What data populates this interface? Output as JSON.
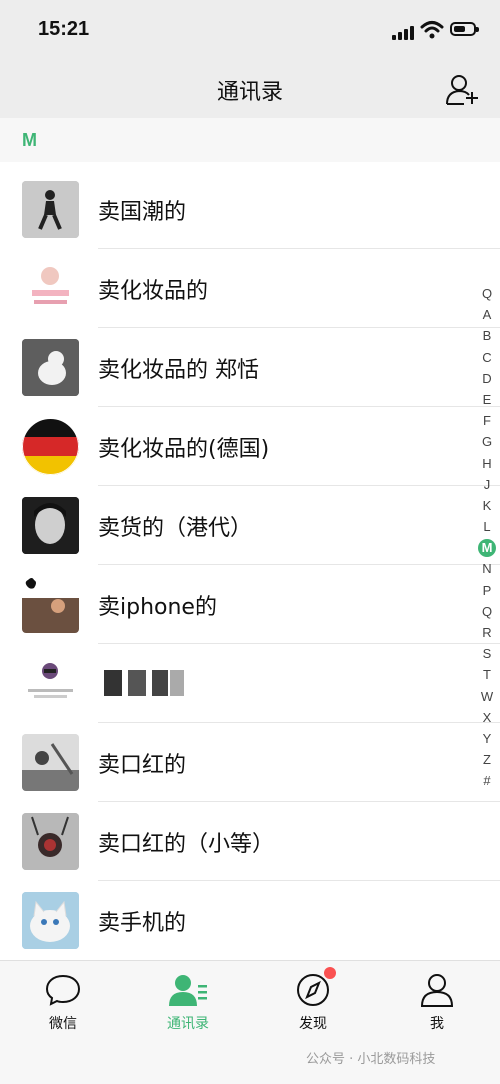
{
  "status_bar": {
    "time": "15:21"
  },
  "header": {
    "title": "通讯录"
  },
  "section_letter": "M",
  "contacts": [
    {
      "name": "卖国潮的"
    },
    {
      "name": "卖化妆品的"
    },
    {
      "name": "卖化妆品的 郑恬"
    },
    {
      "name": "卖化妆品的(德国)"
    },
    {
      "name": "卖货的（港代）"
    },
    {
      "name": "卖iphone的"
    },
    {
      "name": ""
    },
    {
      "name": "卖口红的"
    },
    {
      "name": "卖口红的（小等）"
    },
    {
      "name": "卖手机的"
    }
  ],
  "index_letters": [
    "Q",
    "A",
    "B",
    "C",
    "D",
    "E",
    "F",
    "G",
    "H",
    "J",
    "K",
    "L",
    "M",
    "N",
    "P",
    "Q",
    "R",
    "S",
    "T",
    "W",
    "X",
    "Y",
    "Z",
    "#"
  ],
  "index_active": "M",
  "tabs": [
    {
      "label": "微信",
      "icon": "chat-bubble-icon"
    },
    {
      "label": "通讯录",
      "icon": "contacts-icon"
    },
    {
      "label": "发现",
      "icon": "compass-icon"
    },
    {
      "label": "我",
      "icon": "person-icon"
    }
  ],
  "accent_color": "#3eb575",
  "badge_color": "#fa5151",
  "watermark": "公众号 · 小北数码科技"
}
